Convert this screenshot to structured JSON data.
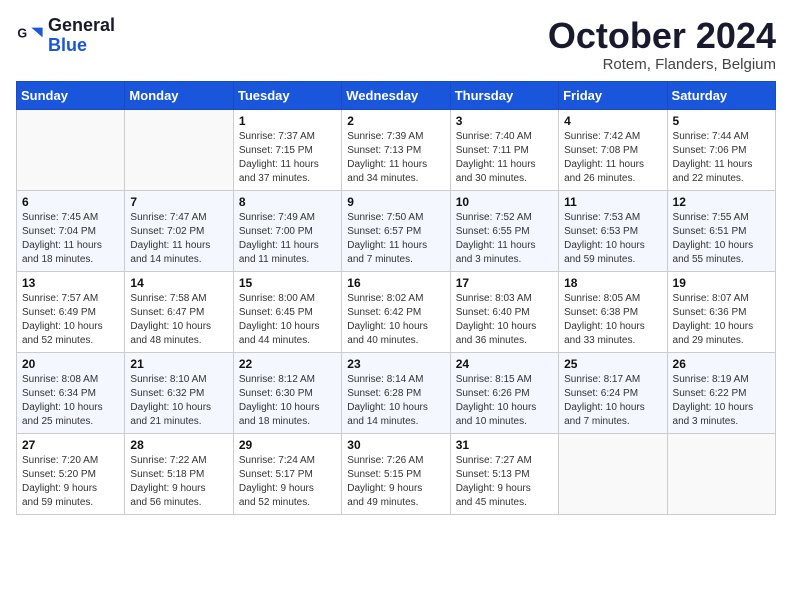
{
  "header": {
    "logo_line1": "General",
    "logo_line2": "Blue",
    "month_title": "October 2024",
    "location": "Rotem, Flanders, Belgium"
  },
  "days_of_week": [
    "Sunday",
    "Monday",
    "Tuesday",
    "Wednesday",
    "Thursday",
    "Friday",
    "Saturday"
  ],
  "weeks": [
    [
      {
        "num": "",
        "detail": ""
      },
      {
        "num": "",
        "detail": ""
      },
      {
        "num": "1",
        "detail": "Sunrise: 7:37 AM\nSunset: 7:15 PM\nDaylight: 11 hours\nand 37 minutes."
      },
      {
        "num": "2",
        "detail": "Sunrise: 7:39 AM\nSunset: 7:13 PM\nDaylight: 11 hours\nand 34 minutes."
      },
      {
        "num": "3",
        "detail": "Sunrise: 7:40 AM\nSunset: 7:11 PM\nDaylight: 11 hours\nand 30 minutes."
      },
      {
        "num": "4",
        "detail": "Sunrise: 7:42 AM\nSunset: 7:08 PM\nDaylight: 11 hours\nand 26 minutes."
      },
      {
        "num": "5",
        "detail": "Sunrise: 7:44 AM\nSunset: 7:06 PM\nDaylight: 11 hours\nand 22 minutes."
      }
    ],
    [
      {
        "num": "6",
        "detail": "Sunrise: 7:45 AM\nSunset: 7:04 PM\nDaylight: 11 hours\nand 18 minutes."
      },
      {
        "num": "7",
        "detail": "Sunrise: 7:47 AM\nSunset: 7:02 PM\nDaylight: 11 hours\nand 14 minutes."
      },
      {
        "num": "8",
        "detail": "Sunrise: 7:49 AM\nSunset: 7:00 PM\nDaylight: 11 hours\nand 11 minutes."
      },
      {
        "num": "9",
        "detail": "Sunrise: 7:50 AM\nSunset: 6:57 PM\nDaylight: 11 hours\nand 7 minutes."
      },
      {
        "num": "10",
        "detail": "Sunrise: 7:52 AM\nSunset: 6:55 PM\nDaylight: 11 hours\nand 3 minutes."
      },
      {
        "num": "11",
        "detail": "Sunrise: 7:53 AM\nSunset: 6:53 PM\nDaylight: 10 hours\nand 59 minutes."
      },
      {
        "num": "12",
        "detail": "Sunrise: 7:55 AM\nSunset: 6:51 PM\nDaylight: 10 hours\nand 55 minutes."
      }
    ],
    [
      {
        "num": "13",
        "detail": "Sunrise: 7:57 AM\nSunset: 6:49 PM\nDaylight: 10 hours\nand 52 minutes."
      },
      {
        "num": "14",
        "detail": "Sunrise: 7:58 AM\nSunset: 6:47 PM\nDaylight: 10 hours\nand 48 minutes."
      },
      {
        "num": "15",
        "detail": "Sunrise: 8:00 AM\nSunset: 6:45 PM\nDaylight: 10 hours\nand 44 minutes."
      },
      {
        "num": "16",
        "detail": "Sunrise: 8:02 AM\nSunset: 6:42 PM\nDaylight: 10 hours\nand 40 minutes."
      },
      {
        "num": "17",
        "detail": "Sunrise: 8:03 AM\nSunset: 6:40 PM\nDaylight: 10 hours\nand 36 minutes."
      },
      {
        "num": "18",
        "detail": "Sunrise: 8:05 AM\nSunset: 6:38 PM\nDaylight: 10 hours\nand 33 minutes."
      },
      {
        "num": "19",
        "detail": "Sunrise: 8:07 AM\nSunset: 6:36 PM\nDaylight: 10 hours\nand 29 minutes."
      }
    ],
    [
      {
        "num": "20",
        "detail": "Sunrise: 8:08 AM\nSunset: 6:34 PM\nDaylight: 10 hours\nand 25 minutes."
      },
      {
        "num": "21",
        "detail": "Sunrise: 8:10 AM\nSunset: 6:32 PM\nDaylight: 10 hours\nand 21 minutes."
      },
      {
        "num": "22",
        "detail": "Sunrise: 8:12 AM\nSunset: 6:30 PM\nDaylight: 10 hours\nand 18 minutes."
      },
      {
        "num": "23",
        "detail": "Sunrise: 8:14 AM\nSunset: 6:28 PM\nDaylight: 10 hours\nand 14 minutes."
      },
      {
        "num": "24",
        "detail": "Sunrise: 8:15 AM\nSunset: 6:26 PM\nDaylight: 10 hours\nand 10 minutes."
      },
      {
        "num": "25",
        "detail": "Sunrise: 8:17 AM\nSunset: 6:24 PM\nDaylight: 10 hours\nand 7 minutes."
      },
      {
        "num": "26",
        "detail": "Sunrise: 8:19 AM\nSunset: 6:22 PM\nDaylight: 10 hours\nand 3 minutes."
      }
    ],
    [
      {
        "num": "27",
        "detail": "Sunrise: 7:20 AM\nSunset: 5:20 PM\nDaylight: 9 hours\nand 59 minutes."
      },
      {
        "num": "28",
        "detail": "Sunrise: 7:22 AM\nSunset: 5:18 PM\nDaylight: 9 hours\nand 56 minutes."
      },
      {
        "num": "29",
        "detail": "Sunrise: 7:24 AM\nSunset: 5:17 PM\nDaylight: 9 hours\nand 52 minutes."
      },
      {
        "num": "30",
        "detail": "Sunrise: 7:26 AM\nSunset: 5:15 PM\nDaylight: 9 hours\nand 49 minutes."
      },
      {
        "num": "31",
        "detail": "Sunrise: 7:27 AM\nSunset: 5:13 PM\nDaylight: 9 hours\nand 45 minutes."
      },
      {
        "num": "",
        "detail": ""
      },
      {
        "num": "",
        "detail": ""
      }
    ]
  ]
}
